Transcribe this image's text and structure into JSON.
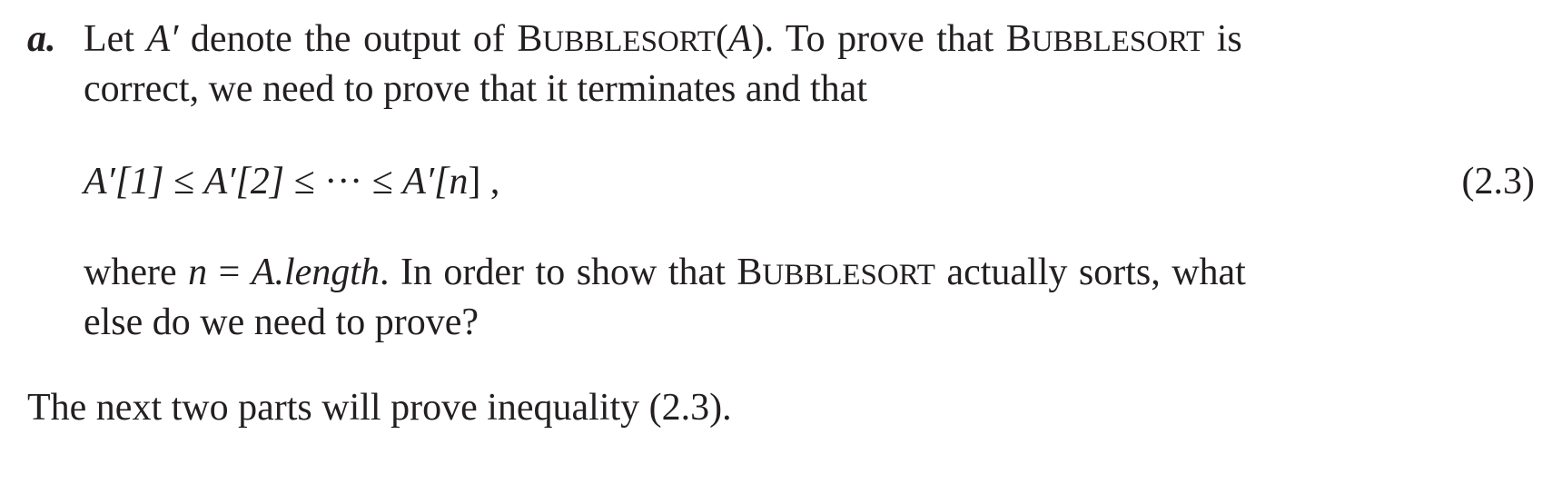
{
  "part_a": {
    "label": "a.",
    "line1": {
      "t1": "Let ",
      "a_prime": "A′",
      "t2": " denote the output of ",
      "bubblesort_B": "B",
      "bubblesort_rest": "UBBLESORT",
      "paren_open": "(",
      "arg": "A",
      "paren_close": ")",
      "t3": ". To prove that ",
      "bubblesort2_B": "B",
      "bubblesort2_rest": "UBBLESORT",
      "t4": " is"
    },
    "line2": "correct, we need to prove that it terminates and that",
    "equation": {
      "lhs1": "A′[1]",
      "op1": " ≤ ",
      "lhs2": "A′[2]",
      "op2": " ≤ ··· ≤ ",
      "lhs3": "A′[",
      "n": "n",
      "close": "]",
      "comma": " ,"
    },
    "equation_number": "(2.3)",
    "line4": {
      "t1": "where ",
      "n": "n",
      "eq": " = ",
      "a_length": "A.length",
      "t2": ". In order to show that ",
      "bubblesort_B": "B",
      "bubblesort_rest": "UBBLESORT",
      "t3": " actually sorts, what"
    },
    "line5": "else do we need to prove?"
  },
  "closing": "The next two parts will prove inequality (2.3)."
}
